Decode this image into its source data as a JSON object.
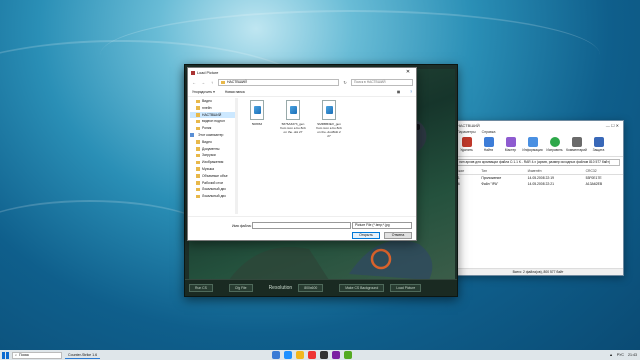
{
  "dialog": {
    "title": "Load Picture",
    "address_current": "НАСТВШИЙ",
    "search_placeholder": "Поиск в НАСТВШИЙ",
    "organize_label": "Упорядочить ▾",
    "new_folder_label": "Новая папка",
    "sidebar": [
      {
        "label": "Видео",
        "selected": false
      },
      {
        "label": "плейн",
        "selected": false
      },
      {
        "label": "НАСТВШИЙ",
        "selected": true
      },
      {
        "label": "видеоп подгол",
        "selected": false
      },
      {
        "label": "Ролик",
        "selected": false
      },
      {
        "label": "Этот компьютер",
        "selected": false,
        "pc": true
      },
      {
        "label": "Видео",
        "selected": false
      },
      {
        "label": "Документы",
        "selected": false
      },
      {
        "label": "Загрузки",
        "selected": false
      },
      {
        "label": "Изображения",
        "selected": false
      },
      {
        "label": "Музыка",
        "selected": false
      },
      {
        "label": "Объемные объе",
        "selected": false
      },
      {
        "label": "Рабочий стол",
        "selected": false
      },
      {
        "label": "Локальный дис",
        "selected": false
      },
      {
        "label": "Локальный дис",
        "selected": false
      }
    ],
    "files": [
      {
        "name": "508863"
      },
      {
        "name": "5876A6373_gen from icon a bo 8nb on the..dot 27"
      },
      {
        "name": "SMRBB3EX_gen from icon a bo 8nb on the..doc8kitt 2 27"
      }
    ],
    "filename_label": "Имя файла:",
    "filename_value": "",
    "filter_label": "Picture File (*.bmp;*.jpg",
    "open_label": "Открыть",
    "cancel_label": "Отмена"
  },
  "game": {
    "buttons": [
      "Run CS",
      "Cfg File",
      "Resolution",
      "Make CS Background",
      "Load Picture"
    ],
    "resolution_value": "800x600"
  },
  "archiver": {
    "title": "НАСТВШИЙ",
    "menu": [
      "Параметры",
      "Справка"
    ],
    "tools": [
      {
        "label": "Удалить",
        "color": "#c0392b"
      },
      {
        "label": "Найти",
        "color": "#3d7dd8"
      },
      {
        "label": "Мастер",
        "color": "#8e5bd0"
      },
      {
        "label": "Информация",
        "color": "#4a90e2"
      },
      {
        "label": "Исправить",
        "color": "#2ea84a"
      },
      {
        "label": "Комментарий",
        "color": "#6a6a6a"
      },
      {
        "label": "Защита",
        "color": "#3968b8"
      }
    ],
    "path": "лин архив для архивации файла C:1.1 К - RAR 4.x (архив, размер исходных файлов 810 577 байт)",
    "columns": [
      "Сжат",
      "Тип",
      "Изменён",
      "CRC32"
    ],
    "rows": [
      [
        "21",
        "Приложение",
        "14.05.2008 22:19",
        "53F0E17E"
      ],
      [
        "96",
        "Файл \"IPA\"",
        "14.05.2008 22:21",
        "A13A62EB"
      ]
    ],
    "status": "Всего: 2 файла(ов), 800 577 байт"
  },
  "taskbar": {
    "search_placeholder": "Поиск",
    "active_app": "Counter-Strike 1.6",
    "language": "РУС",
    "time": "21:43"
  }
}
